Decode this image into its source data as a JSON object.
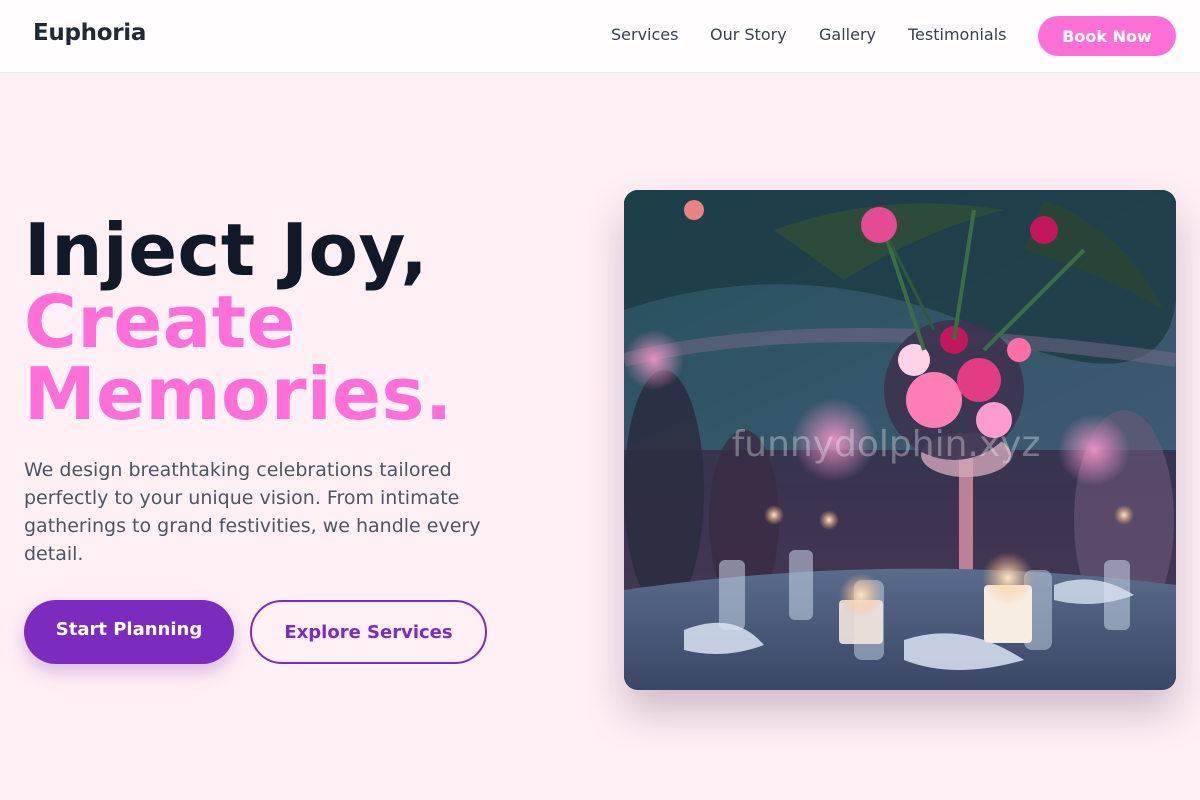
{
  "header": {
    "logo": "Euphoria",
    "nav": [
      "Services",
      "Our Story",
      "Gallery",
      "Testimonials"
    ],
    "cta_label": "Book Now"
  },
  "hero": {
    "headline_line1": "Inject Joy,",
    "headline_line2": "Create",
    "headline_line3": "Memories.",
    "lead": "We design breathtaking celebrations tailored perfectly to your unique vision. From intimate gatherings to grand festivities, we handle every detail.",
    "primary_button": "Start Planning",
    "secondary_button": "Explore Services",
    "image_watermark": "funnydolphin.xyz"
  },
  "colors": {
    "accent_pink": "#ff6fd8",
    "accent_purple": "#7b2cbf",
    "background": "#fff0f5",
    "heading": "#111827"
  }
}
